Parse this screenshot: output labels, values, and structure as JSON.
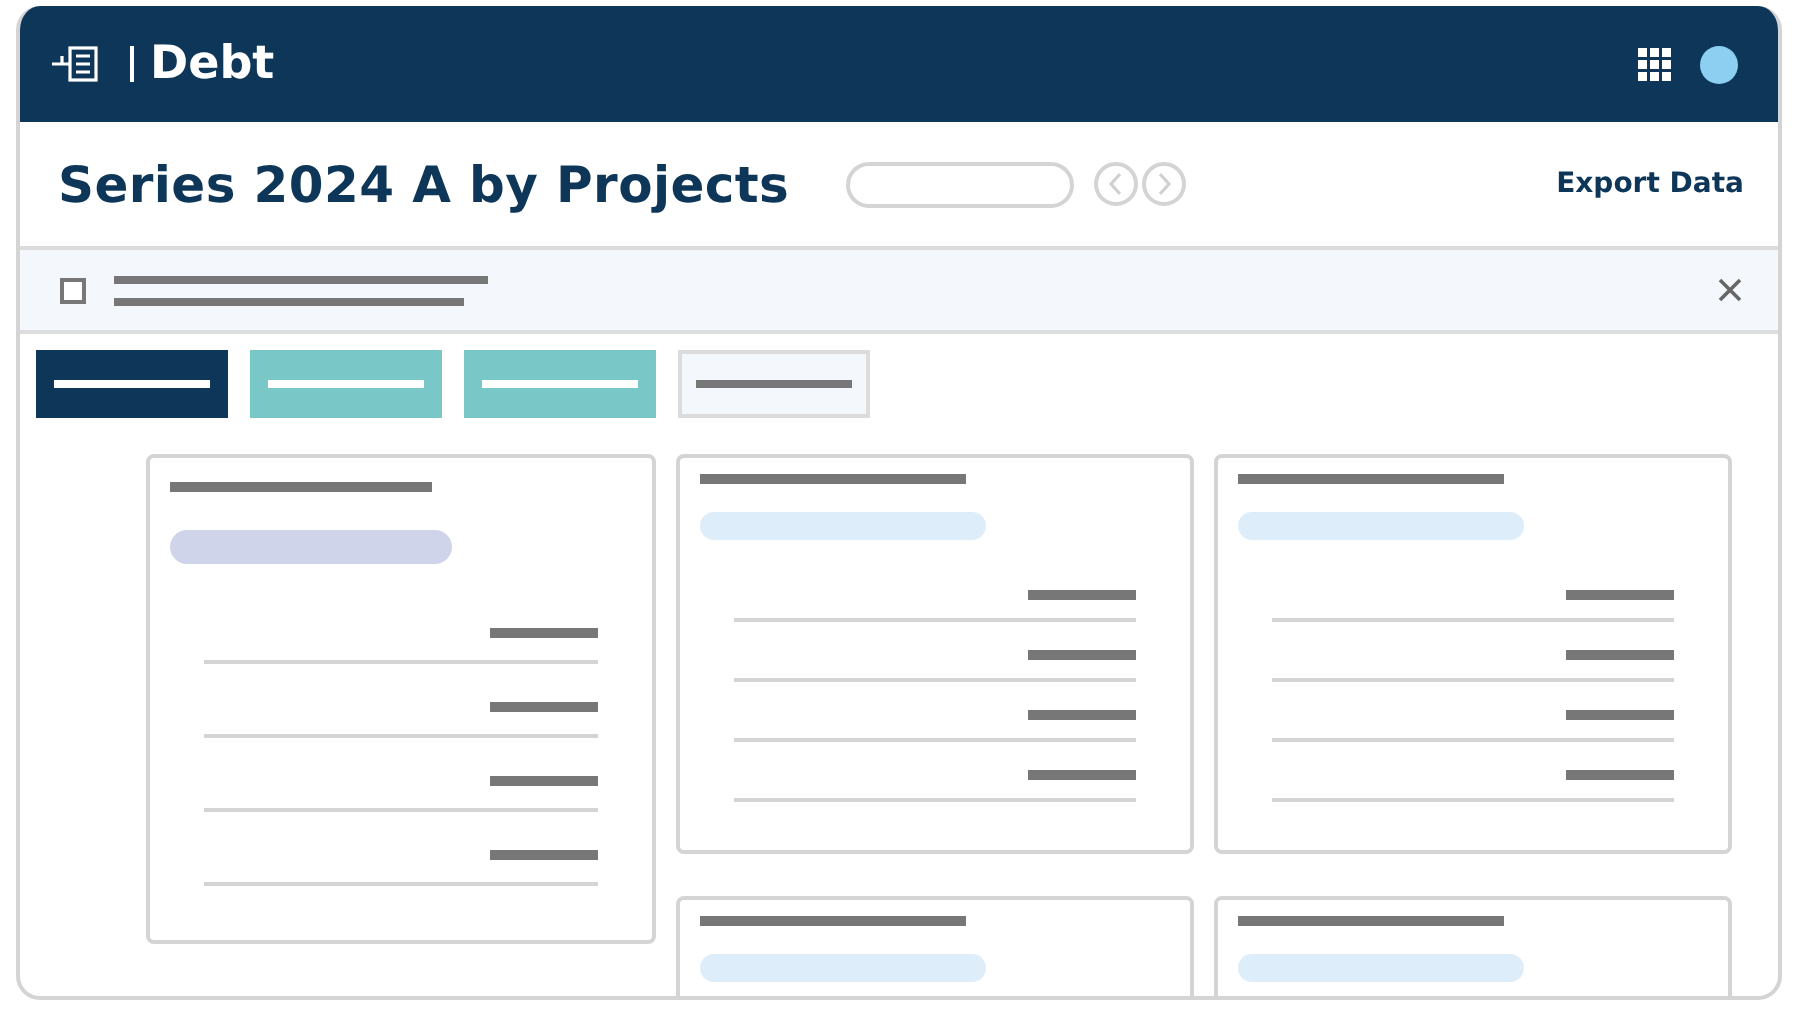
{
  "header": {
    "app_title": "Debt"
  },
  "page": {
    "title": "Series 2024 A by Projects",
    "export_link": "Export Data"
  },
  "notice": {
    "checked": false
  },
  "tabs": [
    {
      "selected": true,
      "kind": "solid"
    },
    {
      "selected": false,
      "kind": "solid"
    },
    {
      "selected": false,
      "kind": "solid"
    },
    {
      "selected": false,
      "kind": "outline"
    }
  ],
  "cards": [
    {
      "color": "#d0d4ea",
      "kind": "full"
    },
    {
      "color": "#deedfa",
      "kind": "full"
    },
    {
      "color": "#deedfa",
      "kind": "full"
    },
    {
      "color": "#deedfa",
      "kind": "partial"
    },
    {
      "color": "#deedfa",
      "kind": "partial"
    }
  ]
}
